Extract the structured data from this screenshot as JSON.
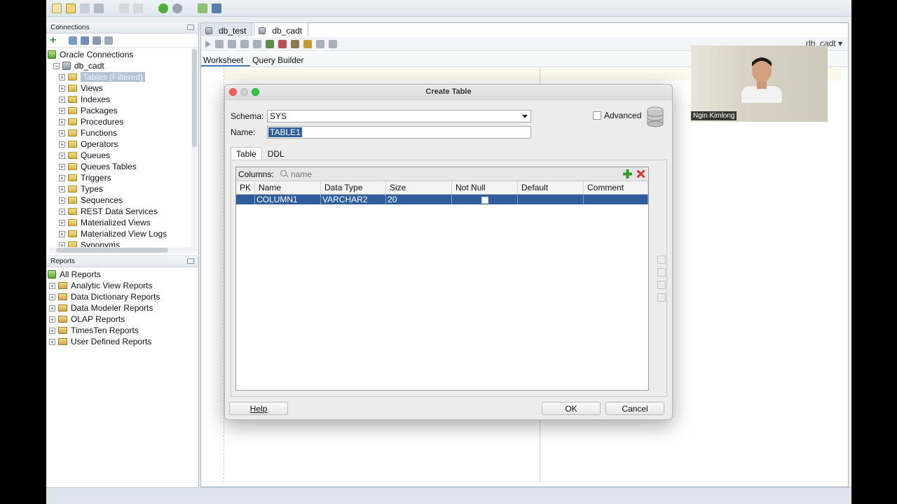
{
  "connections_panel": {
    "title": "Connections",
    "tree": [
      {
        "label": "Oracle Connections",
        "level": 0,
        "icon": "connections-icon"
      },
      {
        "label": "db_cadt",
        "level": 1,
        "icon": "database-icon"
      },
      {
        "label": "Tables (Filtered)",
        "level": 2,
        "icon": "folder-icon",
        "selected": true
      },
      {
        "label": "Views",
        "level": 2,
        "icon": "folder-icon"
      },
      {
        "label": "Indexes",
        "level": 2,
        "icon": "folder-icon"
      },
      {
        "label": "Packages",
        "level": 2,
        "icon": "folder-icon"
      },
      {
        "label": "Procedures",
        "level": 2,
        "icon": "folder-icon"
      },
      {
        "label": "Functions",
        "level": 2,
        "icon": "folder-icon"
      },
      {
        "label": "Operators",
        "level": 2,
        "icon": "folder-icon"
      },
      {
        "label": "Queues",
        "level": 2,
        "icon": "folder-icon"
      },
      {
        "label": "Queues Tables",
        "level": 2,
        "icon": "folder-icon"
      },
      {
        "label": "Triggers",
        "level": 2,
        "icon": "folder-icon"
      },
      {
        "label": "Types",
        "level": 2,
        "icon": "folder-icon"
      },
      {
        "label": "Sequences",
        "level": 2,
        "icon": "folder-icon"
      },
      {
        "label": "REST Data Services",
        "level": 2,
        "icon": "folder-icon"
      },
      {
        "label": "Materialized Views",
        "level": 2,
        "icon": "folder-icon"
      },
      {
        "label": "Materialized View Logs",
        "level": 2,
        "icon": "folder-icon"
      },
      {
        "label": "Synonyms",
        "level": 2,
        "icon": "folder-icon"
      }
    ]
  },
  "reports_panel": {
    "title": "Reports",
    "tree": [
      {
        "label": "All Reports",
        "level": 0
      },
      {
        "label": "Analytic View Reports",
        "level": 1
      },
      {
        "label": "Data Dictionary Reports",
        "level": 1
      },
      {
        "label": "Data Modeler Reports",
        "level": 1
      },
      {
        "label": "OLAP Reports",
        "level": 1
      },
      {
        "label": "TimesTen Reports",
        "level": 1
      },
      {
        "label": "User Defined Reports",
        "level": 1
      }
    ]
  },
  "editor": {
    "tabs": [
      {
        "label": "db_test",
        "active": false
      },
      {
        "label": "db_cadt",
        "active": true
      }
    ],
    "connection_selector": "db_cadt",
    "sub_tabs": [
      {
        "label": "Worksheet",
        "active": true
      },
      {
        "label": "Query Builder",
        "active": false
      }
    ]
  },
  "dialog": {
    "title": "Create Table",
    "schema_label": "Schema:",
    "schema_value": "SYS",
    "name_label": "Name:",
    "name_value": "TABLE1",
    "advanced_label": "Advanced",
    "advanced_checked": false,
    "tabs": [
      {
        "label": "Table",
        "active": true
      },
      {
        "label": "DDL",
        "active": false
      }
    ],
    "columns_label": "Columns:",
    "columns_search_placeholder": "name",
    "column_headers": [
      "PK",
      "Name",
      "Data Type",
      "Size",
      "Not Null",
      "Default",
      "Comment"
    ],
    "rows": [
      {
        "pk": "",
        "name": "COLUMN1",
        "data_type": "VARCHAR2",
        "size": "20",
        "not_null": false,
        "default": "",
        "comment": "",
        "selected": true
      }
    ],
    "buttons": {
      "help": "Help",
      "ok": "OK",
      "cancel": "Cancel"
    }
  },
  "webcam": {
    "participant_name": "Ngin Kimlong"
  },
  "colors": {
    "selection": "#2f5e9a",
    "app_bg": "#e9eef3",
    "dialog_bg": "#ececec"
  }
}
